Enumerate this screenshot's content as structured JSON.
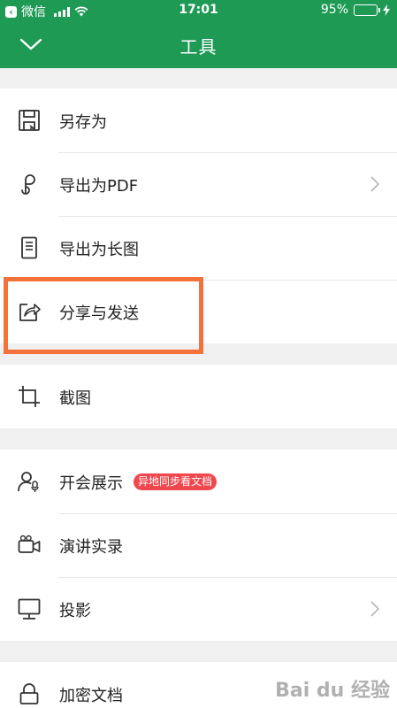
{
  "status_bar": {
    "carrier": "微信",
    "time": "17:01",
    "battery": "95%",
    "battery_level": 0.95
  },
  "header": {
    "title": "工具"
  },
  "menu": {
    "group1": [
      {
        "label": "另存为",
        "icon": "save-icon"
      },
      {
        "label": "导出为PDF",
        "icon": "pdf-export-icon",
        "has_arrow": true
      },
      {
        "label": "导出为长图",
        "icon": "long-image-icon"
      },
      {
        "label": "分享与发送",
        "icon": "share-icon",
        "highlighted": true
      }
    ],
    "group2": [
      {
        "label": "截图",
        "icon": "crop-icon"
      }
    ],
    "group3": [
      {
        "label": "开会展示",
        "icon": "presenter-icon",
        "badge": "异地同步看文档"
      },
      {
        "label": "演讲实录",
        "icon": "video-record-icon"
      },
      {
        "label": "投影",
        "icon": "projector-icon",
        "has_arrow": true
      }
    ],
    "group4": [
      {
        "label": "加密文档",
        "icon": "lock-icon"
      }
    ]
  },
  "watermark": "Bai du 经验"
}
